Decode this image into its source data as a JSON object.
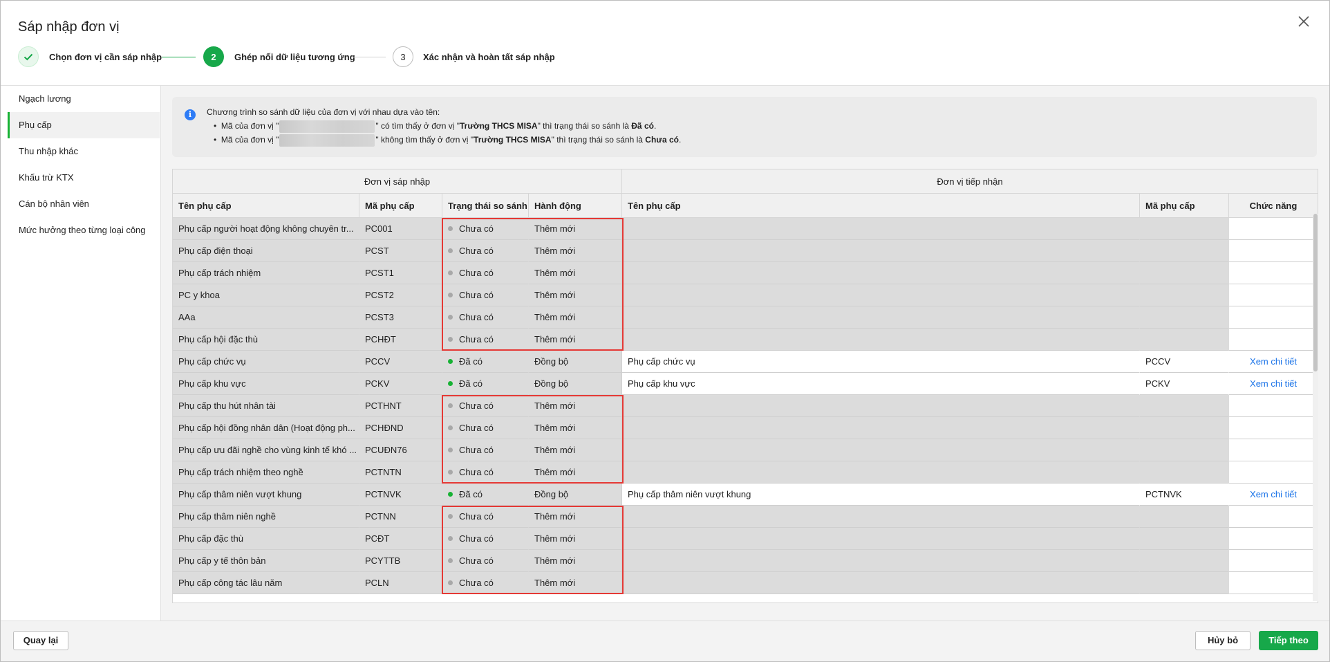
{
  "dialog": {
    "title": "Sáp nhập đơn vị"
  },
  "steps": [
    {
      "number": "✓",
      "label": "Chọn đơn vị cần sáp nhập",
      "state": "done"
    },
    {
      "number": "2",
      "label": "Ghép nối dữ liệu tương ứng",
      "state": "active"
    },
    {
      "number": "3",
      "label": "Xác nhận và hoàn tất sáp nhập",
      "state": "pending"
    }
  ],
  "sidebar": {
    "items": [
      {
        "label": "Ngạch lương",
        "active": false
      },
      {
        "label": "Phụ cấp",
        "active": true
      },
      {
        "label": "Thu nhập khác",
        "active": false
      },
      {
        "label": "Khấu trừ KTX",
        "active": false
      },
      {
        "label": "Cán bộ nhân viên",
        "active": false
      },
      {
        "label": "Mức hưởng theo từng loại công",
        "active": false
      }
    ]
  },
  "info": {
    "intro": "Chương trình so sánh dữ liệu của đơn vị với nhau dựa vào tên:",
    "line1_a": "Mã của đơn vị \"",
    "line1_b": "\" có tìm thấy ở đơn vị \"",
    "line1_unit": "Trường THCS MISA",
    "line1_c": "\" thì trạng thái so sánh là ",
    "line1_status": "Đã có",
    "line2_a": "Mã của đơn vị \"",
    "line2_b": "\" không tìm thấy ở đơn vị \"",
    "line2_unit": "Trường THCS MISA",
    "line2_c": "\" thì trạng thái so sánh là ",
    "line2_status": "Chưa có",
    "period": "."
  },
  "grid": {
    "group_left": "Đơn vị sáp nhập",
    "group_right": "Đơn vị tiếp nhận",
    "columns": {
      "src_name": "Tên phụ cấp",
      "src_code": "Mã phụ cấp",
      "status": "Trạng thái so sánh",
      "action": "Hành động",
      "dst_name": "Tên phụ cấp",
      "dst_code": "Mã phụ cấp",
      "func": "Chức năng"
    },
    "rows": [
      {
        "src_name": "Phụ cấp người hoạt động không chuyên tr...",
        "src_code": "PC001",
        "status": "Chưa có",
        "action": "Thêm mới",
        "dst_name": "",
        "dst_code": "",
        "func": ""
      },
      {
        "src_name": "Phụ cấp điện thoại",
        "src_code": "PCST",
        "status": "Chưa có",
        "action": "Thêm mới",
        "dst_name": "",
        "dst_code": "",
        "func": ""
      },
      {
        "src_name": "Phụ cấp trách nhiệm",
        "src_code": "PCST1",
        "status": "Chưa có",
        "action": "Thêm mới",
        "dst_name": "",
        "dst_code": "",
        "func": ""
      },
      {
        "src_name": "PC y khoa",
        "src_code": "PCST2",
        "status": "Chưa có",
        "action": "Thêm mới",
        "dst_name": "",
        "dst_code": "",
        "func": ""
      },
      {
        "src_name": "AAa",
        "src_code": "PCST3",
        "status": "Chưa có",
        "action": "Thêm mới",
        "dst_name": "",
        "dst_code": "",
        "func": ""
      },
      {
        "src_name": "Phụ cấp hội đặc thù",
        "src_code": "PCHĐT",
        "status": "Chưa có",
        "action": "Thêm mới",
        "dst_name": "",
        "dst_code": "",
        "func": ""
      },
      {
        "src_name": "Phụ cấp chức vụ",
        "src_code": "PCCV",
        "status": "Đã có",
        "action": "Đồng bộ",
        "dst_name": "Phụ cấp chức vụ",
        "dst_code": "PCCV",
        "func": "Xem chi tiết"
      },
      {
        "src_name": "Phụ cấp khu vực",
        "src_code": "PCKV",
        "status": "Đã có",
        "action": "Đồng bộ",
        "dst_name": "Phụ cấp khu vực",
        "dst_code": "PCKV",
        "func": "Xem chi tiết"
      },
      {
        "src_name": "Phụ cấp thu hút nhân tài",
        "src_code": "PCTHNT",
        "status": "Chưa có",
        "action": "Thêm mới",
        "dst_name": "",
        "dst_code": "",
        "func": ""
      },
      {
        "src_name": "Phụ cấp hội đồng nhân dân (Hoạt động ph...",
        "src_code": "PCHĐND",
        "status": "Chưa có",
        "action": "Thêm mới",
        "dst_name": "",
        "dst_code": "",
        "func": ""
      },
      {
        "src_name": "Phụ cấp ưu đãi nghề cho vùng kinh tế khó ...",
        "src_code": "PCUĐN76",
        "status": "Chưa có",
        "action": "Thêm mới",
        "dst_name": "",
        "dst_code": "",
        "func": ""
      },
      {
        "src_name": "Phụ cấp trách nhiệm theo nghề",
        "src_code": "PCTNTN",
        "status": "Chưa có",
        "action": "Thêm mới",
        "dst_name": "",
        "dst_code": "",
        "func": ""
      },
      {
        "src_name": "Phụ cấp thâm niên vượt khung",
        "src_code": "PCTNVK",
        "status": "Đã có",
        "action": "Đồng bộ",
        "dst_name": "Phụ cấp thâm niên vượt khung",
        "dst_code": "PCTNVK",
        "func": "Xem chi tiết"
      },
      {
        "src_name": "Phụ cấp thâm niên nghề",
        "src_code": "PCTNN",
        "status": "Chưa có",
        "action": "Thêm mới",
        "dst_name": "",
        "dst_code": "",
        "func": ""
      },
      {
        "src_name": "Phụ cấp đặc thù",
        "src_code": "PCĐT",
        "status": "Chưa có",
        "action": "Thêm mới",
        "dst_name": "",
        "dst_code": "",
        "func": ""
      },
      {
        "src_name": "Phụ cấp y tế thôn bản",
        "src_code": "PCYTTB",
        "status": "Chưa có",
        "action": "Thêm mới",
        "dst_name": "",
        "dst_code": "",
        "func": ""
      },
      {
        "src_name": "Phụ cấp công tác lâu năm",
        "src_code": "PCLN",
        "status": "Chưa có",
        "action": "Thêm mới",
        "dst_name": "",
        "dst_code": "",
        "func": ""
      }
    ]
  },
  "footer": {
    "back_label": "Quay lại",
    "cancel_label": "Hủy bỏ",
    "next_label": "Tiếp theo"
  },
  "colors": {
    "accent": "#17a84a",
    "status_exists": "#17b234",
    "status_missing": "#a8a8a8",
    "highlight_box": "#e53935",
    "link": "#1a73e8"
  }
}
